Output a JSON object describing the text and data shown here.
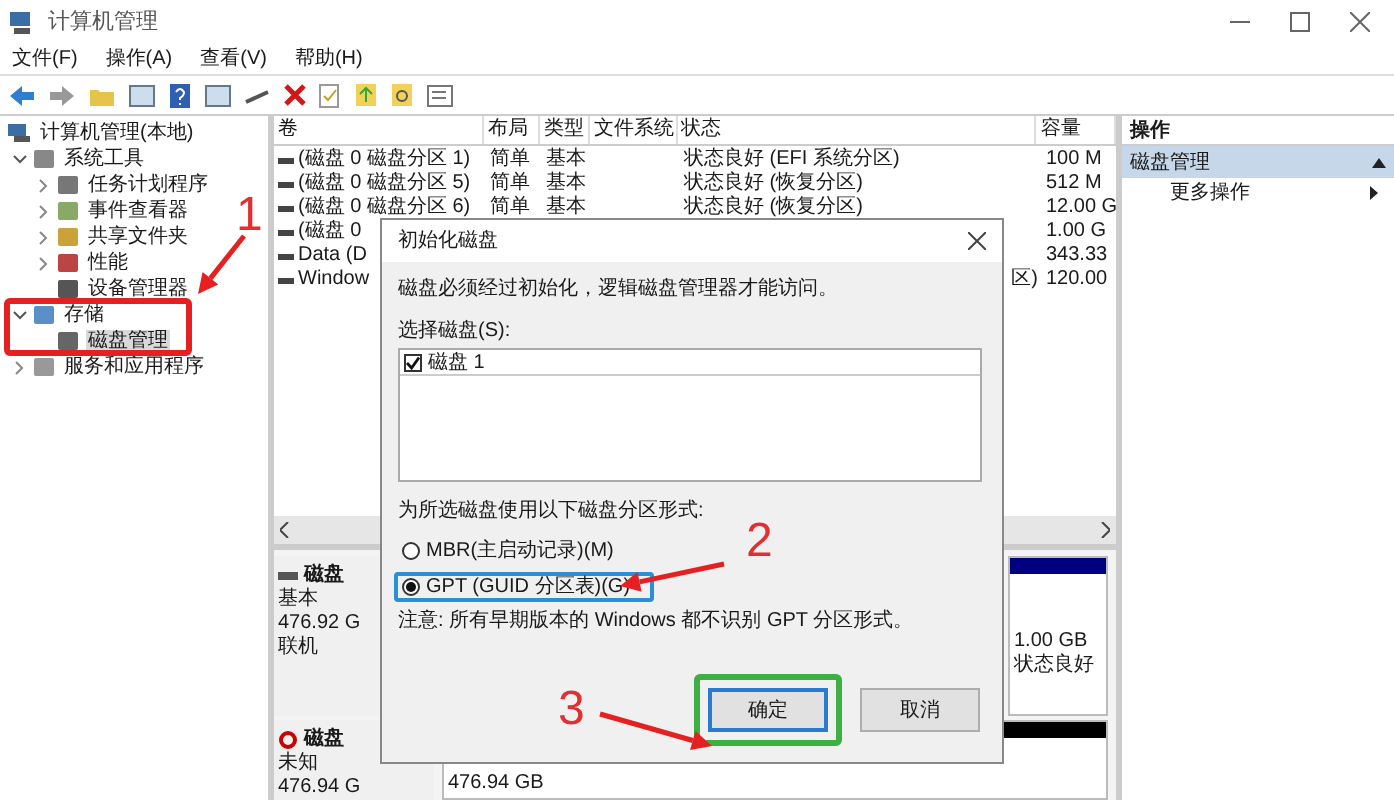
{
  "window": {
    "title": "计算机管理"
  },
  "menu": [
    "文件(F)",
    "操作(A)",
    "查看(V)",
    "帮助(H)"
  ],
  "tree": [
    {
      "label": "计算机管理(本地)",
      "kind": "root",
      "selected": false,
      "children": [
        {
          "label": "系统工具",
          "kind": "node",
          "expanded": true,
          "selected": false,
          "children": [
            {
              "label": "任务计划程序",
              "kind": "node",
              "expanded": false,
              "selected": false
            },
            {
              "label": "事件查看器",
              "kind": "node",
              "expanded": false,
              "selected": false
            },
            {
              "label": "共享文件夹",
              "kind": "node",
              "expanded": false,
              "selected": false
            },
            {
              "label": "性能",
              "kind": "node",
              "expanded": false,
              "selected": false
            },
            {
              "label": "设备管理器",
              "kind": "leaf",
              "selected": false
            }
          ]
        },
        {
          "label": "存储",
          "kind": "node",
          "expanded": true,
          "selected": false,
          "children": [
            {
              "label": "磁盘管理",
              "kind": "leaf",
              "selected": true
            }
          ]
        },
        {
          "label": "服务和应用程序",
          "kind": "node",
          "expanded": false,
          "selected": false
        }
      ]
    }
  ],
  "table": {
    "columns": [
      "卷",
      "布局",
      "类型",
      "文件系统",
      "状态",
      "容量"
    ],
    "rows": [
      {
        "volume": "(磁盘 0 磁盘分区 1)",
        "layout": "简单",
        "type": "基本",
        "status": "状态良好 (EFI 系统分区)",
        "capacity": "100 M"
      },
      {
        "volume": "(磁盘 0 磁盘分区 5)",
        "layout": "简单",
        "type": "基本",
        "status": "状态良好 (恢复分区)",
        "capacity": "512 M"
      },
      {
        "volume": "(磁盘 0 磁盘分区 6)",
        "layout": "简单",
        "type": "基本",
        "status": "状态良好 (恢复分区)",
        "capacity": "12.00 G"
      },
      {
        "volume": "(磁盘 0",
        "capacity": "1.00 G"
      },
      {
        "volume": "Data (D",
        "capacity": "343.33"
      },
      {
        "volume": "Window",
        "status": "区)",
        "capacity": "120.00"
      }
    ]
  },
  "disks": [
    {
      "kind": "online",
      "name": "磁盘",
      "type": "基本",
      "size": "476.92 G",
      "status": "联机",
      "partition": {
        "color": "#000080",
        "size": "1.00 GB",
        "status": "状态良好"
      }
    },
    {
      "kind": "unknown",
      "name": "磁盘",
      "type": "未知",
      "size": "476.94 G",
      "partition": {
        "color": "#000000",
        "size": "476.94 GB"
      }
    }
  ],
  "actions": {
    "title": "操作",
    "section": "磁盘管理",
    "items": [
      "更多操作"
    ]
  },
  "dialog": {
    "title": "初始化磁盘",
    "message": "磁盘必须经过初始化，逻辑磁盘管理器才能访问。",
    "select_label": "选择磁盘(S):",
    "disks": [
      {
        "label": "磁盘 1",
        "checked": true
      }
    ],
    "style_label": "为所选磁盘使用以下磁盘分区形式:",
    "options": [
      {
        "label": "MBR(主启动记录)(M)",
        "selected": false
      },
      {
        "label": "GPT (GUID 分区表)(G)",
        "selected": true
      }
    ],
    "note": "注意: 所有早期版本的 Windows 都不识别 GPT 分区形式。",
    "buttons": [
      {
        "label": "确定",
        "kind": "default"
      },
      {
        "label": "取消",
        "kind": "normal"
      }
    ]
  },
  "annotations": [
    {
      "label": "1"
    },
    {
      "label": "2"
    },
    {
      "label": "3"
    }
  ]
}
